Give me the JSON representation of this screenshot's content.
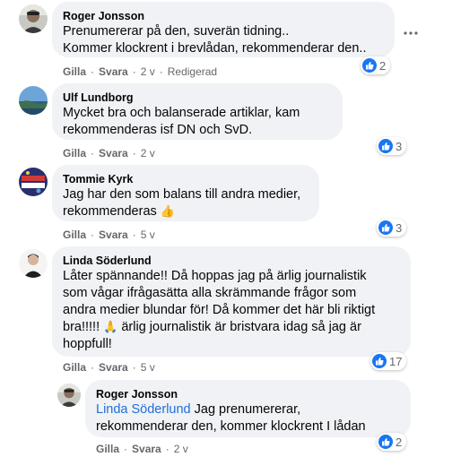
{
  "comments": [
    {
      "author": "Roger Jonsson",
      "text": "Prenumererar på den, suverän tidning..\nKommer klockrent i brevlådan, rekommenderar den..",
      "like": "Gilla",
      "reply": "Svara",
      "time": "2 v",
      "edited": "Redigerad",
      "reactions": "2"
    },
    {
      "author": "Ulf Lundborg",
      "text": "Mycket bra och balanserade artiklar, kam\nrekommenderas isf DN och SvD.",
      "like": "Gilla",
      "reply": "Svara",
      "time": "2 v",
      "reactions": "3"
    },
    {
      "author": "Tommie Kyrk",
      "text": "Jag har den som balans till andra medier,\nrekommenderas",
      "emoji": "👍",
      "like": "Gilla",
      "reply": "Svara",
      "time": "5 v",
      "reactions": "3"
    },
    {
      "author": "Linda Söderlund",
      "text_before": "Låter spännande!! Då hoppas jag på ärlig journalistik\nsom vågar ifrågasätta alla skrämmande frågor som\nandra medier blundar för! Då kommer det här bli riktigt\nbra!!!!! ",
      "emoji": "🙏",
      "text_after": " ärlig journalistik är bristvara idag så jag är\nhoppfull!",
      "like": "Gilla",
      "reply": "Svara",
      "time": "5 v",
      "reactions": "17"
    },
    {
      "author": "Roger Jonsson",
      "mention": "Linda Söderlund",
      "text": " Jag prenumererar,\nrekommenderar den, kommer klockrent I lådan",
      "like": "Gilla",
      "reply": "Svara",
      "time": "2 v",
      "reactions": "2"
    }
  ],
  "separator": "·",
  "icons": {
    "more": "more-horizontal-icon",
    "like": "thumbs-up-icon"
  },
  "colors": {
    "bubble": "#f0f2f5",
    "like_blue": "#1877f2",
    "mention": "#216fdb",
    "meta": "#65676b"
  }
}
